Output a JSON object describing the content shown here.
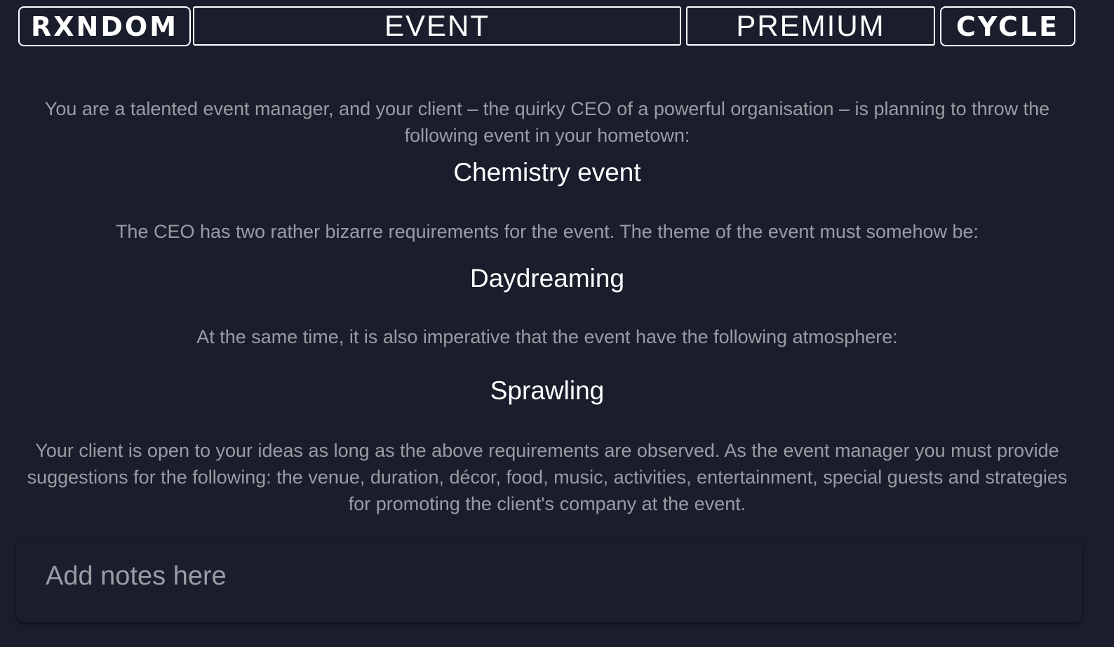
{
  "tabs": {
    "random": "RXNDOM",
    "event": "EVENT",
    "premium": "PREMIUM",
    "cycle": "CYCLE"
  },
  "prompt": {
    "intro": "You are a talented event manager, and your client – the quirky CEO of a powerful organisation – is planning to throw the following event in your hometown:",
    "event_type": "Chemistry event",
    "requirements_intro": "The CEO has two rather bizarre requirements for the event. The theme of the event must somehow be:",
    "theme": "Daydreaming",
    "atmosphere_intro": "At the same time, it is also imperative that the event have the following atmosphere:",
    "atmosphere": "Sprawling",
    "closing": "Your client is open to your ideas as long as the above requirements are observed. As the event manager you must provide suggestions for the following: the venue, duration, décor, food, music, activities, entertainment, special guests and strategies for promoting the client's company at the event."
  },
  "notes": {
    "placeholder": "Add notes here",
    "value": ""
  },
  "colors": {
    "background": "#1a1e2c",
    "text_muted": "#9a9ca3",
    "text_highlight": "#ffffff",
    "tab_border": "#ffffff"
  }
}
